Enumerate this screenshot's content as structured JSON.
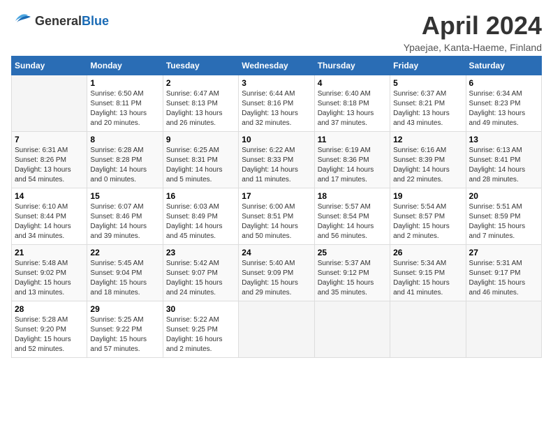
{
  "header": {
    "logo_general": "General",
    "logo_blue": "Blue",
    "title": "April 2024",
    "location": "Ypaejae, Kanta-Haeme, Finland"
  },
  "calendar": {
    "days_of_week": [
      "Sunday",
      "Monday",
      "Tuesday",
      "Wednesday",
      "Thursday",
      "Friday",
      "Saturday"
    ],
    "weeks": [
      [
        {
          "day": "",
          "info": ""
        },
        {
          "day": "1",
          "info": "Sunrise: 6:50 AM\nSunset: 8:11 PM\nDaylight: 13 hours\nand 20 minutes."
        },
        {
          "day": "2",
          "info": "Sunrise: 6:47 AM\nSunset: 8:13 PM\nDaylight: 13 hours\nand 26 minutes."
        },
        {
          "day": "3",
          "info": "Sunrise: 6:44 AM\nSunset: 8:16 PM\nDaylight: 13 hours\nand 32 minutes."
        },
        {
          "day": "4",
          "info": "Sunrise: 6:40 AM\nSunset: 8:18 PM\nDaylight: 13 hours\nand 37 minutes."
        },
        {
          "day": "5",
          "info": "Sunrise: 6:37 AM\nSunset: 8:21 PM\nDaylight: 13 hours\nand 43 minutes."
        },
        {
          "day": "6",
          "info": "Sunrise: 6:34 AM\nSunset: 8:23 PM\nDaylight: 13 hours\nand 49 minutes."
        }
      ],
      [
        {
          "day": "7",
          "info": "Sunrise: 6:31 AM\nSunset: 8:26 PM\nDaylight: 13 hours\nand 54 minutes."
        },
        {
          "day": "8",
          "info": "Sunrise: 6:28 AM\nSunset: 8:28 PM\nDaylight: 14 hours\nand 0 minutes."
        },
        {
          "day": "9",
          "info": "Sunrise: 6:25 AM\nSunset: 8:31 PM\nDaylight: 14 hours\nand 5 minutes."
        },
        {
          "day": "10",
          "info": "Sunrise: 6:22 AM\nSunset: 8:33 PM\nDaylight: 14 hours\nand 11 minutes."
        },
        {
          "day": "11",
          "info": "Sunrise: 6:19 AM\nSunset: 8:36 PM\nDaylight: 14 hours\nand 17 minutes."
        },
        {
          "day": "12",
          "info": "Sunrise: 6:16 AM\nSunset: 8:39 PM\nDaylight: 14 hours\nand 22 minutes."
        },
        {
          "day": "13",
          "info": "Sunrise: 6:13 AM\nSunset: 8:41 PM\nDaylight: 14 hours\nand 28 minutes."
        }
      ],
      [
        {
          "day": "14",
          "info": "Sunrise: 6:10 AM\nSunset: 8:44 PM\nDaylight: 14 hours\nand 34 minutes."
        },
        {
          "day": "15",
          "info": "Sunrise: 6:07 AM\nSunset: 8:46 PM\nDaylight: 14 hours\nand 39 minutes."
        },
        {
          "day": "16",
          "info": "Sunrise: 6:03 AM\nSunset: 8:49 PM\nDaylight: 14 hours\nand 45 minutes."
        },
        {
          "day": "17",
          "info": "Sunrise: 6:00 AM\nSunset: 8:51 PM\nDaylight: 14 hours\nand 50 minutes."
        },
        {
          "day": "18",
          "info": "Sunrise: 5:57 AM\nSunset: 8:54 PM\nDaylight: 14 hours\nand 56 minutes."
        },
        {
          "day": "19",
          "info": "Sunrise: 5:54 AM\nSunset: 8:57 PM\nDaylight: 15 hours\nand 2 minutes."
        },
        {
          "day": "20",
          "info": "Sunrise: 5:51 AM\nSunset: 8:59 PM\nDaylight: 15 hours\nand 7 minutes."
        }
      ],
      [
        {
          "day": "21",
          "info": "Sunrise: 5:48 AM\nSunset: 9:02 PM\nDaylight: 15 hours\nand 13 minutes."
        },
        {
          "day": "22",
          "info": "Sunrise: 5:45 AM\nSunset: 9:04 PM\nDaylight: 15 hours\nand 18 minutes."
        },
        {
          "day": "23",
          "info": "Sunrise: 5:42 AM\nSunset: 9:07 PM\nDaylight: 15 hours\nand 24 minutes."
        },
        {
          "day": "24",
          "info": "Sunrise: 5:40 AM\nSunset: 9:09 PM\nDaylight: 15 hours\nand 29 minutes."
        },
        {
          "day": "25",
          "info": "Sunrise: 5:37 AM\nSunset: 9:12 PM\nDaylight: 15 hours\nand 35 minutes."
        },
        {
          "day": "26",
          "info": "Sunrise: 5:34 AM\nSunset: 9:15 PM\nDaylight: 15 hours\nand 41 minutes."
        },
        {
          "day": "27",
          "info": "Sunrise: 5:31 AM\nSunset: 9:17 PM\nDaylight: 15 hours\nand 46 minutes."
        }
      ],
      [
        {
          "day": "28",
          "info": "Sunrise: 5:28 AM\nSunset: 9:20 PM\nDaylight: 15 hours\nand 52 minutes."
        },
        {
          "day": "29",
          "info": "Sunrise: 5:25 AM\nSunset: 9:22 PM\nDaylight: 15 hours\nand 57 minutes."
        },
        {
          "day": "30",
          "info": "Sunrise: 5:22 AM\nSunset: 9:25 PM\nDaylight: 16 hours\nand 2 minutes."
        },
        {
          "day": "",
          "info": ""
        },
        {
          "day": "",
          "info": ""
        },
        {
          "day": "",
          "info": ""
        },
        {
          "day": "",
          "info": ""
        }
      ]
    ]
  }
}
